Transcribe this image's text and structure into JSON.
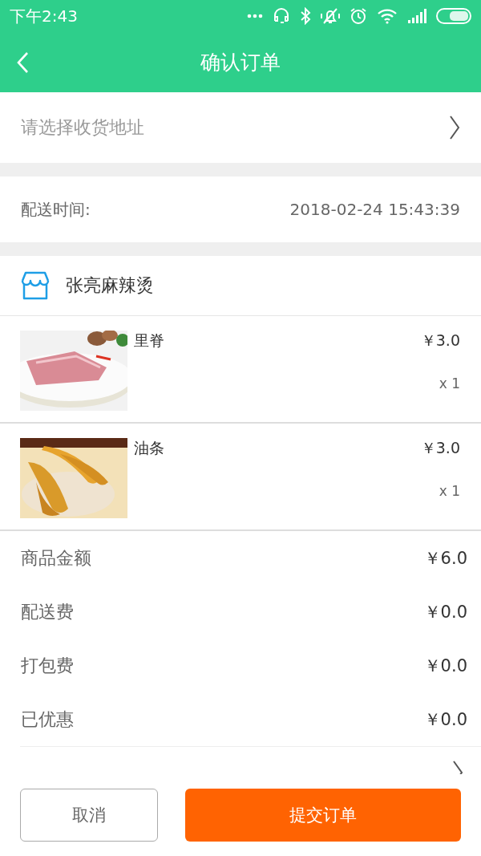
{
  "status_bar": {
    "time": "下午2:43"
  },
  "header": {
    "title": "确认订单"
  },
  "address": {
    "placeholder": "请选择收货地址"
  },
  "delivery": {
    "label": "配送时间:",
    "value": "2018-02-24 15:43:39"
  },
  "shop": {
    "name": "张亮麻辣烫"
  },
  "items": [
    {
      "name": "里脊",
      "price": "￥3.0",
      "quantity": "x 1"
    },
    {
      "name": "油条",
      "price": "￥3.0",
      "quantity": "x 1"
    }
  ],
  "summary": [
    {
      "label": "商品金额",
      "value": "￥6.0"
    },
    {
      "label": "配送费",
      "value": "￥0.0"
    },
    {
      "label": "打包费",
      "value": "￥0.0"
    },
    {
      "label": "已优惠",
      "value": "￥0.0"
    }
  ],
  "buttons": [
    {
      "kind": "secondary",
      "label": "取消"
    },
    {
      "kind": "primary",
      "label": "提交订单"
    }
  ]
}
